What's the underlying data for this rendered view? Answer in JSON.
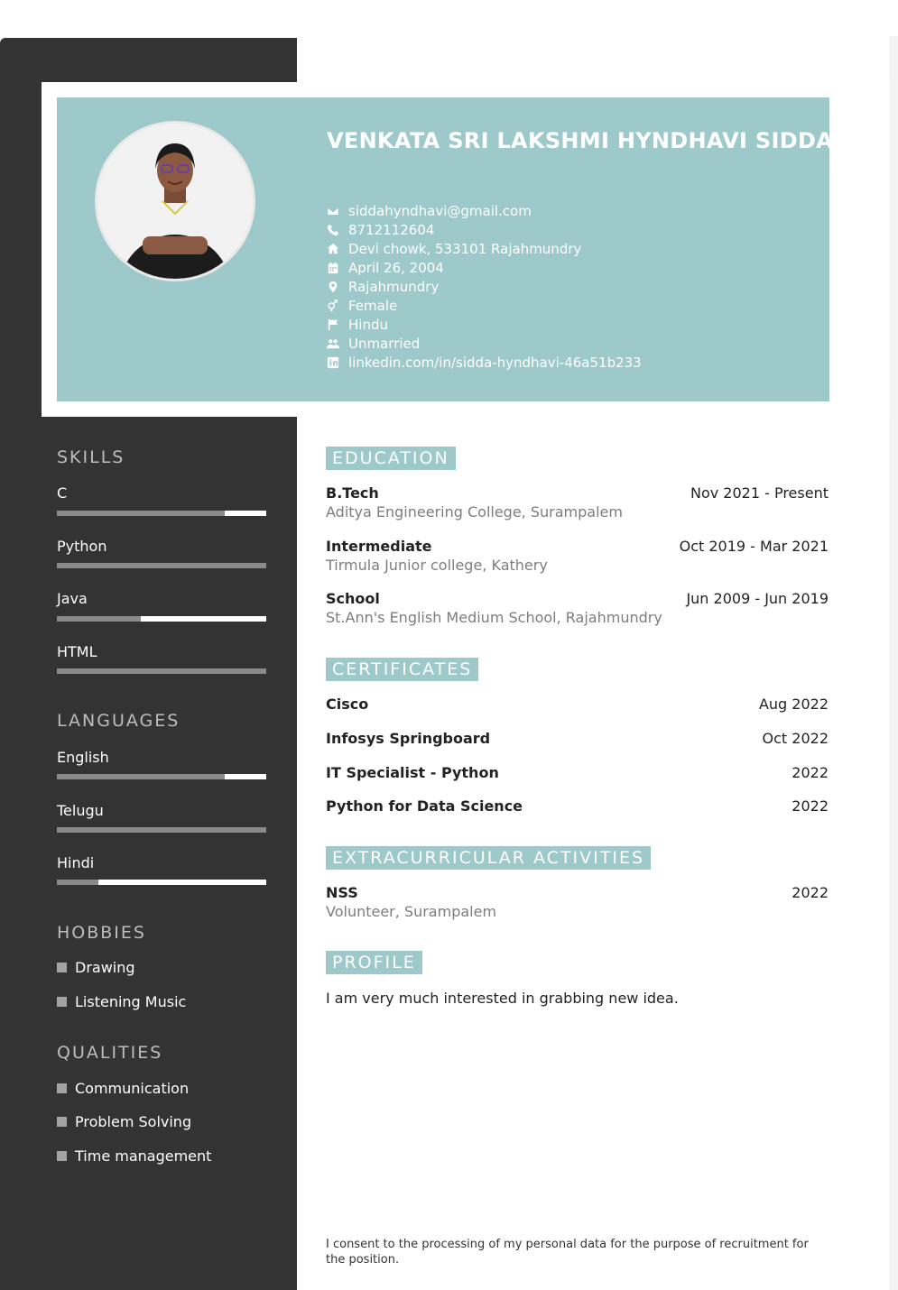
{
  "header": {
    "name": "VENKATA SRI LAKSHMI HYNDHAVI SIDDA",
    "contacts": [
      {
        "icon": "envelope-icon",
        "text": "siddahyndhavi@gmail.com"
      },
      {
        "icon": "phone-icon",
        "text": "8712112604"
      },
      {
        "icon": "home-icon",
        "text": "Devi chowk, 533101 Rajahmundry"
      },
      {
        "icon": "calendar-icon",
        "text": "April 26, 2004"
      },
      {
        "icon": "location-pin-icon",
        "text": "Rajahmundry"
      },
      {
        "icon": "gender-icon",
        "text": "Female"
      },
      {
        "icon": "flag-icon",
        "text": "Hindu"
      },
      {
        "icon": "users-icon",
        "text": "Unmarried"
      },
      {
        "icon": "linkedin-icon",
        "text": "linkedin.com/in/sidda-hyndhavi-46a51b233"
      }
    ]
  },
  "sidebar": {
    "skills_heading": "SKILLS",
    "skills": [
      {
        "name": "C",
        "level": 0.8
      },
      {
        "name": "Python",
        "level": 1.0
      },
      {
        "name": "Java",
        "level": 0.4
      },
      {
        "name": "HTML",
        "level": 1.0
      }
    ],
    "languages_heading": "LANGUAGES",
    "languages": [
      {
        "name": "English",
        "level": 0.8
      },
      {
        "name": "Telugu",
        "level": 1.0
      },
      {
        "name": "Hindi",
        "level": 0.2
      }
    ],
    "hobbies_heading": "HOBBIES",
    "hobbies": [
      "Drawing",
      "Listening Music"
    ],
    "qualities_heading": "QUALITIES",
    "qualities": [
      "Communication",
      "Problem Solving",
      "Time management"
    ]
  },
  "education": {
    "heading": "EDUCATION",
    "items": [
      {
        "title": "B.Tech",
        "sub": "Aditya Engineering College, Surampalem",
        "date": "Nov 2021 - Present"
      },
      {
        "title": "Intermediate",
        "sub": "Tirmula Junior college, Kathery",
        "date": "Oct 2019 - Mar 2021"
      },
      {
        "title": "School",
        "sub": "St.Ann's English Medium School, Rajahmundry",
        "date": "Jun 2009 - Jun 2019"
      }
    ]
  },
  "certificates": {
    "heading": "CERTIFICATES",
    "items": [
      {
        "title": "Cisco",
        "date": "Aug 2022"
      },
      {
        "title": "Infosys Springboard",
        "date": "Oct 2022"
      },
      {
        "title": "IT Specialist - Python",
        "date": "2022"
      },
      {
        "title": "Python for Data Science",
        "date": "2022"
      }
    ]
  },
  "extracurricular": {
    "heading": "EXTRACURRICULAR ACTIVITIES",
    "items": [
      {
        "title": "NSS",
        "sub": "Volunteer, Surampalem",
        "date": "2022"
      }
    ]
  },
  "profile": {
    "heading": "PROFILE",
    "text": "I am very much interested in grabbing new idea."
  },
  "consent": "I consent to the processing of my personal data for the purpose of recruitment for the position.",
  "colors": {
    "accent": "#9ec9ca",
    "sidebar": "#333333",
    "bar_track": "#8a8a8a",
    "bar_fill": "#ffffff"
  }
}
